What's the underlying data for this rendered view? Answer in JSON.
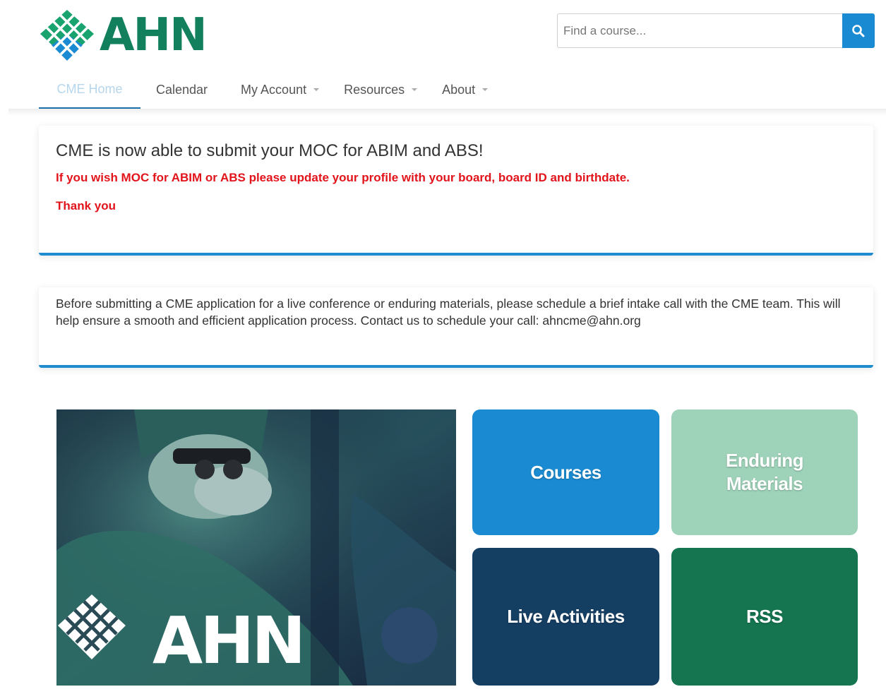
{
  "brand": {
    "name": "AHN",
    "color": "#12805c"
  },
  "search": {
    "placeholder": "Find a course...",
    "icon": "search-icon"
  },
  "nav": {
    "items": [
      {
        "label": "CME Home",
        "active": true
      },
      {
        "label": "Calendar"
      },
      {
        "label": "My Account",
        "dropdown": true
      },
      {
        "label": "Resources",
        "dropdown": true
      },
      {
        "label": "About",
        "dropdown": true
      }
    ]
  },
  "notice": {
    "title": "CME is now able to submit your MOC for ABIM and ABS!",
    "line1": "If you wish MOC for ABIM or ABS please update your profile with your board, board ID and birthdate.",
    "line2": "Thank you"
  },
  "intake": {
    "text": "Before submitting a CME application for a live conference or enduring materials, please schedule a brief intake call with the CME team.  This will help ensure a smooth and efficient application process.  Contact us to schedule your call:  ahncme@ahn.org"
  },
  "hero": {
    "logo_text": "AHN"
  },
  "tiles": [
    {
      "label": "Courses",
      "color": "#1a8bd2"
    },
    {
      "label": "Enduring Materials",
      "color": "#9ed2b9"
    },
    {
      "label": "Live Activities",
      "color": "#153e63"
    },
    {
      "label": "RSS",
      "color": "#147550"
    }
  ]
}
